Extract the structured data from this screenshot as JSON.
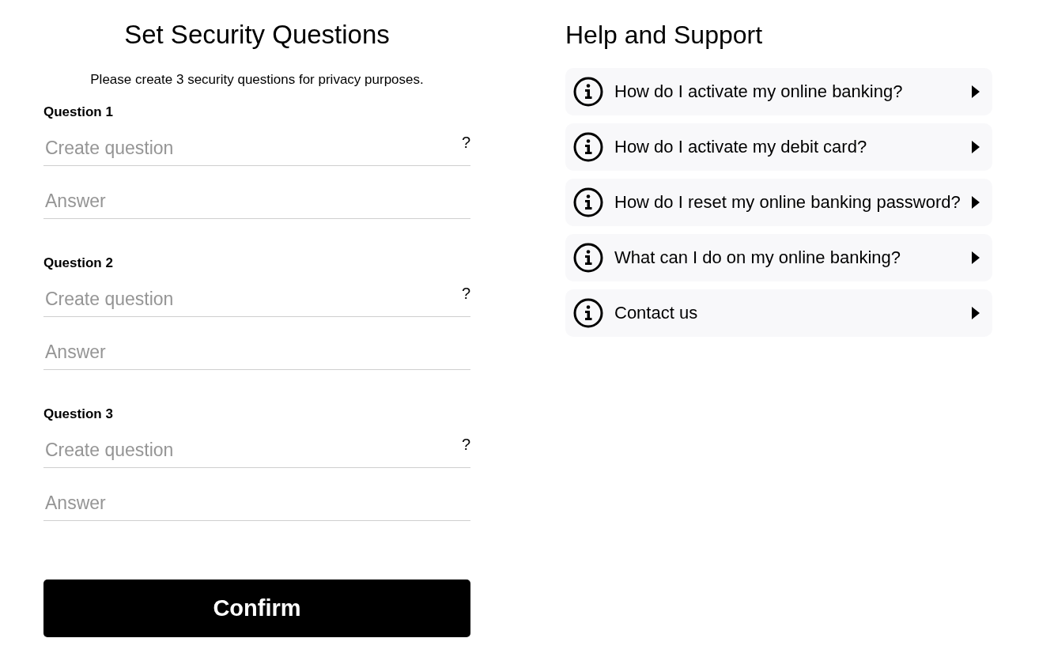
{
  "form": {
    "title": "Set Security Questions",
    "subtitle": "Please create 3 security questions for privacy purposes.",
    "questions": [
      {
        "label": "Question 1",
        "question_placeholder": "Create question",
        "help": "?",
        "answer_placeholder": "Answer"
      },
      {
        "label": "Question 2",
        "question_placeholder": "Create question",
        "help": "?",
        "answer_placeholder": "Answer"
      },
      {
        "label": "Question 3",
        "question_placeholder": "Create question",
        "help": "?",
        "answer_placeholder": "Answer"
      }
    ],
    "confirm_button": "Confirm"
  },
  "help": {
    "title": "Help and Support",
    "items": [
      {
        "label": "How do I activate my online banking?"
      },
      {
        "label": "How do I activate my debit card?"
      },
      {
        "label": "How do I reset my online banking password?"
      },
      {
        "label": "What can I do on my online banking?"
      },
      {
        "label": "Contact us"
      }
    ]
  }
}
